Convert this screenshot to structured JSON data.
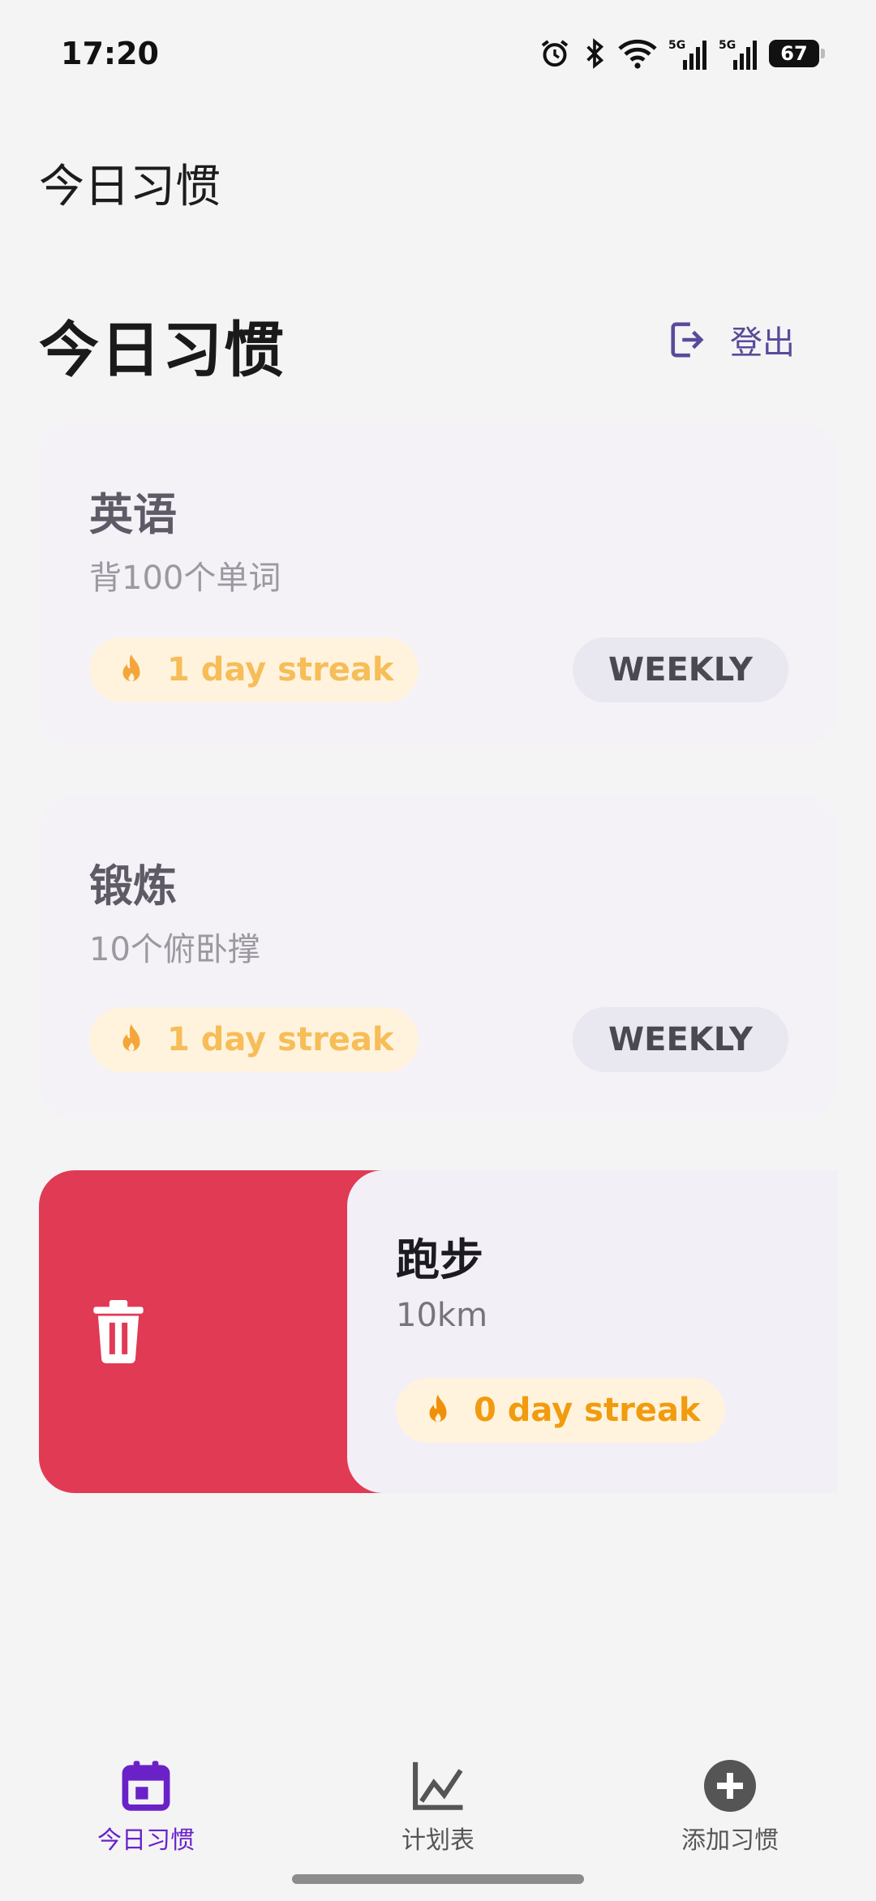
{
  "status": {
    "time": "17:20",
    "battery": "67"
  },
  "appbar": {
    "title": "今日习惯"
  },
  "header": {
    "title": "今日习惯",
    "logout_label": "登出"
  },
  "habits": [
    {
      "title": "英语",
      "subtitle": "背100个单词",
      "streak": "1 day streak",
      "frequency": "WEEKLY"
    },
    {
      "title": "锻炼",
      "subtitle": "10个俯卧撑",
      "streak": "1 day streak",
      "frequency": "WEEKLY"
    },
    {
      "title": "跑步",
      "subtitle": "10km",
      "streak": "0 day streak"
    }
  ],
  "nav": {
    "items": [
      {
        "label": "今日习惯",
        "icon": "calendar-icon",
        "active": true
      },
      {
        "label": "计划表",
        "icon": "chart-icon"
      },
      {
        "label": "添加习惯",
        "icon": "add-circle-icon"
      }
    ]
  },
  "colors": {
    "accent": "#6a22c8",
    "delete": "#e03a55",
    "streak": "#f6bd58"
  }
}
